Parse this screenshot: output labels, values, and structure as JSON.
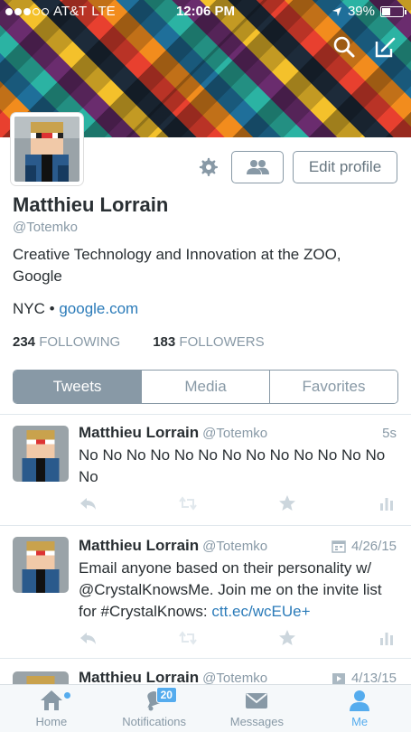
{
  "status": {
    "carrier": "AT&T",
    "network": "LTE",
    "time": "12:06 PM",
    "battery": "39%",
    "battery_level": 0.39
  },
  "header": {
    "icons": [
      "search-icon",
      "compose-icon"
    ]
  },
  "profile": {
    "name": "Matthieu Lorrain",
    "handle": "@Totemko",
    "bio": "Creative Technology and Innovation at the ZOO, Google",
    "location": "NYC",
    "separator": "•",
    "website": "google.com",
    "following_count": "234",
    "following_label": "FOLLOWING",
    "followers_count": "183",
    "followers_label": "FOLLOWERS",
    "edit_label": "Edit profile"
  },
  "tabs": [
    {
      "label": "Tweets",
      "active": true
    },
    {
      "label": "Media",
      "active": false
    },
    {
      "label": "Favorites",
      "active": false
    }
  ],
  "tweets": [
    {
      "name": "Matthieu Lorrain",
      "handle": "@Totemko",
      "time": "5s",
      "text": "No No No No No No No No No No No No No No"
    },
    {
      "name": "Matthieu Lorrain",
      "handle": "@Totemko",
      "time": "4/26/15",
      "text": "Email anyone based on their personality w/ @CrystalKnowsMe. Join me on the invite list for #CrystalKnows: ",
      "link": "ctt.ec/wcEUe+"
    },
    {
      "name": "Matthieu Lorrain",
      "handle": "@Totemko",
      "time": "4/13/15"
    }
  ],
  "tabbar": [
    {
      "label": "Home",
      "icon": "home-icon"
    },
    {
      "label": "Notifications",
      "icon": "bell-icon",
      "badge": "20"
    },
    {
      "label": "Messages",
      "icon": "envelope-icon"
    },
    {
      "label": "Me",
      "icon": "person-icon",
      "active": true
    }
  ],
  "colors": {
    "accent": "#55acee",
    "link": "#2b7bb9",
    "muted": "#8899a6",
    "text": "#292f33"
  }
}
